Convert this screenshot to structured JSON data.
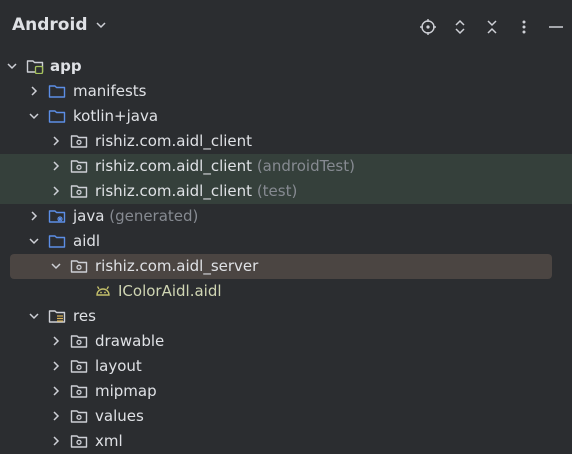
{
  "panel": {
    "title": "Android"
  },
  "toolbar": [
    "locate-icon",
    "expand-collapse-icon",
    "collapse-all-icon",
    "more-options-icon",
    "hide-panel-icon"
  ],
  "tree": {
    "app": "app",
    "manifests": "manifests",
    "kotlin_java": "kotlin+java",
    "pkg_main": "rishiz.com.aidl_client",
    "pkg_android_test": "rishiz.com.aidl_client",
    "pkg_android_test_suffix": "(androidTest)",
    "pkg_test": "rishiz.com.aidl_client",
    "pkg_test_suffix": "(test)",
    "java": "java",
    "java_suffix": "(generated)",
    "aidl": "aidl",
    "pkg_server": "rishiz.com.aidl_server",
    "aidl_file": "IColorAidl.aidl",
    "res": "res",
    "drawable": "drawable",
    "layout": "layout",
    "mipmap": "mipmap",
    "values": "values",
    "xml": "xml"
  },
  "colors": {
    "background": "#2b2d30",
    "folder": "#5c8ee6",
    "highlight": "#35403b",
    "selection": "#4b4542",
    "android": "#c4c06a"
  }
}
